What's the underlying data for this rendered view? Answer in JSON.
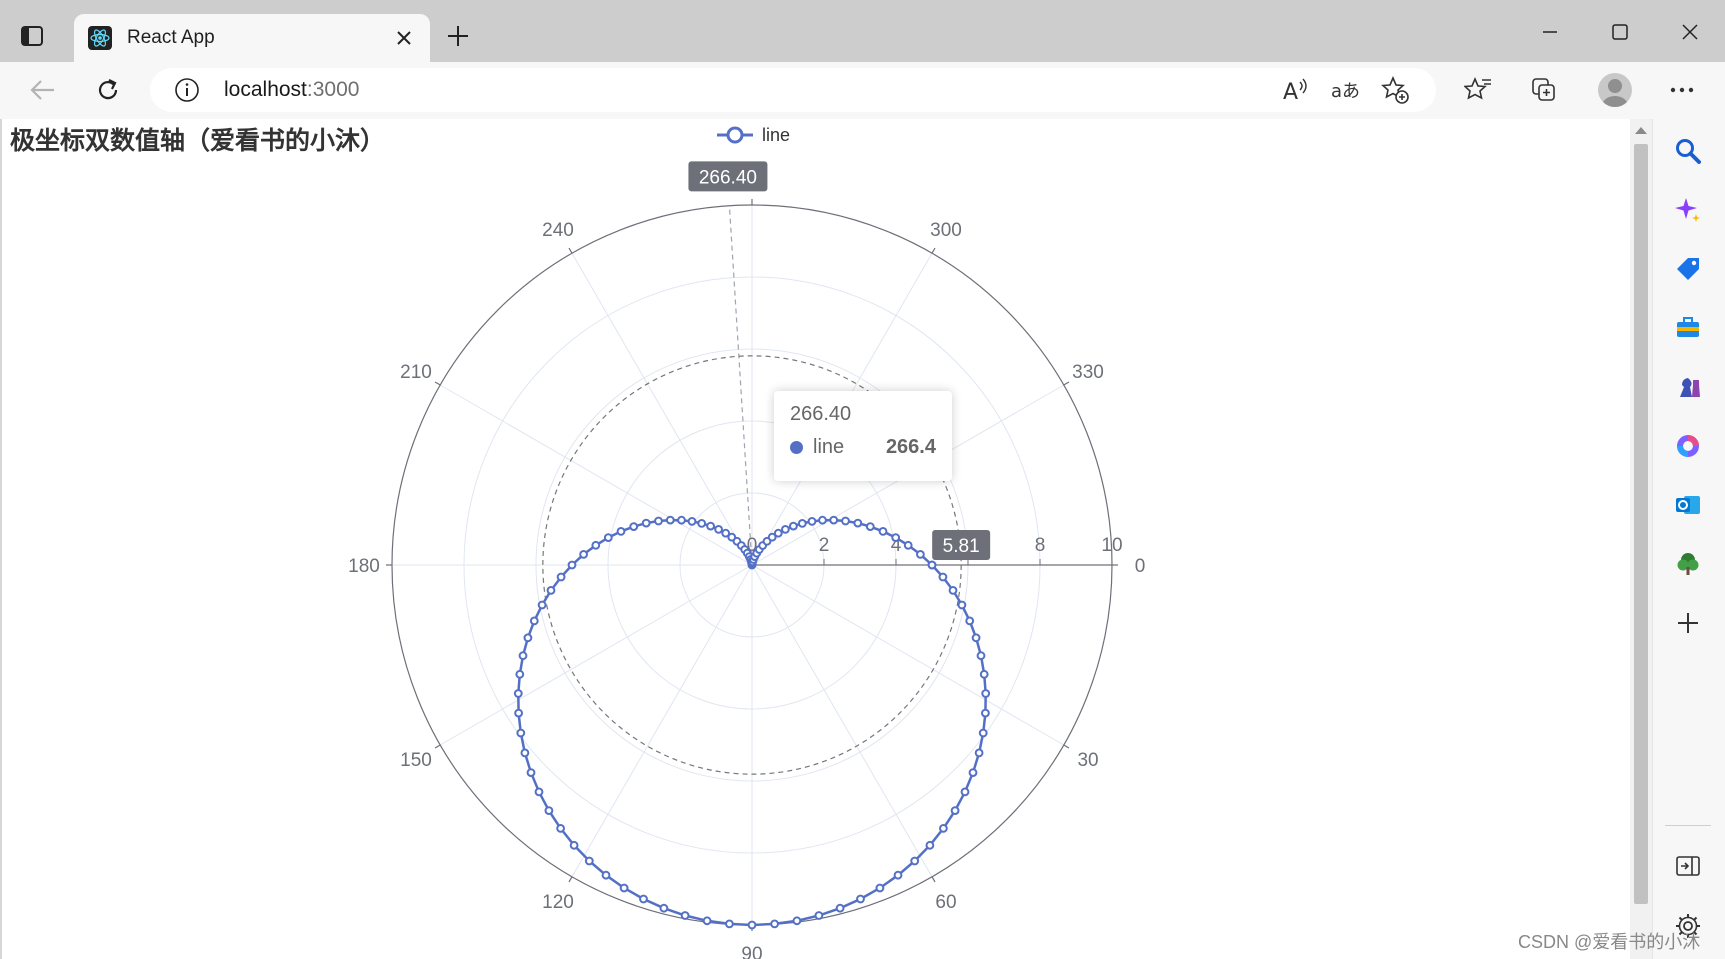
{
  "browser": {
    "tab_title": "React App",
    "url_host": "localhost",
    "url_port": ":3000",
    "accent": "#5470c6"
  },
  "page": {
    "title": "极坐标双数值轴（爱看书的小沐）",
    "watermark": "CSDN @爱看书的小沐"
  },
  "tooltip": {
    "title": "266.40",
    "series": "line",
    "value": "266.4"
  },
  "chart_data": {
    "type": "line",
    "coordinate_system": "polar",
    "title": "极坐标双数值轴（爱看书的小沐）",
    "legend": [
      "line"
    ],
    "legend_position": "top-center",
    "series": [
      {
        "name": "line",
        "color": "#5470c6",
        "formula": "r = 5 * (1 + sin(theta))",
        "points_every_degrees": 3.6,
        "points": [
          {
            "angle": 0,
            "r": 5.0
          },
          {
            "angle": 30,
            "r": 7.5
          },
          {
            "angle": 60,
            "r": 9.33
          },
          {
            "angle": 90,
            "r": 10.0
          },
          {
            "angle": 120,
            "r": 9.33
          },
          {
            "angle": 150,
            "r": 7.5
          },
          {
            "angle": 180,
            "r": 5.0
          },
          {
            "angle": 210,
            "r": 2.5
          },
          {
            "angle": 240,
            "r": 0.67
          },
          {
            "angle": 270,
            "r": 0.0
          },
          {
            "angle": 300,
            "r": 0.67
          },
          {
            "angle": 330,
            "r": 2.5
          }
        ]
      }
    ],
    "angle_axis": {
      "type": "value",
      "min": 0,
      "max": 360,
      "clockwise": true,
      "start_angle": 0,
      "tick_labels": [
        "0",
        "30",
        "60",
        "90",
        "120",
        "150",
        "180",
        "210",
        "240",
        "270",
        "300",
        "330"
      ]
    },
    "radius_axis": {
      "type": "value",
      "min": 0,
      "max": 10,
      "tick_labels": [
        "0",
        "2",
        "4",
        "6",
        "8",
        "10"
      ]
    },
    "axis_pointer": {
      "angle_label": "266.40",
      "radius_label": "5.81"
    },
    "grid": true
  }
}
